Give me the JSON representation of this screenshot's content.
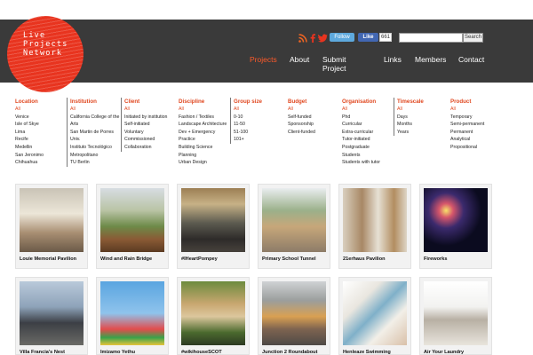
{
  "logo": {
    "line1": "Live",
    "line2": "Projects",
    "line3": "Network"
  },
  "social": {
    "follow_label": "Follow",
    "like_label": "Like",
    "like_count": "661"
  },
  "search": {
    "button_label": "Search",
    "value": ""
  },
  "nav": {
    "items": [
      "Projects",
      "About",
      "Submit",
      "Project",
      "Links",
      "Members",
      "Contact"
    ]
  },
  "colors": {
    "accent": "#e0471f",
    "header_bg": "#3a3a3a",
    "logo_red": "#e8341f"
  },
  "filters": {
    "location": {
      "title": "Location",
      "all": "All",
      "items": [
        "Venice",
        "Isle of Skye",
        "Lima",
        "Recife",
        "Medellin",
        "San Jeronimo",
        "Chihuahua"
      ]
    },
    "institution": {
      "title": "Institution",
      "all": "All",
      "items": [
        "California College of the",
        "Arts",
        "San Martin de Porres",
        "Univ.",
        "Instituto Tecnológico",
        "Metropolitano",
        "TU Berlin"
      ]
    },
    "client": {
      "title": "Client",
      "all": "All",
      "items": [
        "Initiated by institution",
        "Self-initiated",
        "Voluntary",
        "Commissioned",
        "Collaboration"
      ]
    },
    "discipline": {
      "title": "Discipline",
      "all": "All",
      "items": [
        "Fashion / Textiles",
        "Landscape Architecture",
        "Dev + Emergency",
        "Practice",
        "Building Science",
        "Planning",
        "Urban Design"
      ]
    },
    "group_size": {
      "title": "Group size",
      "all": "All",
      "items": [
        "0-10",
        "11-50",
        "51-100",
        "101+"
      ]
    },
    "budget": {
      "title": "Budget",
      "all": "All",
      "items": [
        "Self-funded",
        "Sponsorship",
        "Client-funded"
      ]
    },
    "organisation": {
      "title": "Organisation",
      "all": "All",
      "items": [
        "Phd",
        "Curricular",
        "Extra-curricular",
        "Tutor-initiated",
        "Postgraduate",
        "Students",
        "Students with tutor"
      ]
    },
    "timescale": {
      "title": "Timescale",
      "all": "All",
      "items": [
        "Days",
        "Months",
        "Years"
      ]
    },
    "product": {
      "title": "Product",
      "all": "All",
      "items": [
        "Temporary",
        "Semi-permanent",
        "Permanent",
        "Analytical",
        "Propositional"
      ]
    }
  },
  "projects": [
    {
      "title": "Louie Memorial Pavilion",
      "image": "classroom-photo"
    },
    {
      "title": "Wind and Rain Bridge",
      "image": "bridge-photo"
    },
    {
      "title": "#IHeartPompey",
      "image": "group-photo"
    },
    {
      "title": "Primary School Tunnel",
      "image": "tunnel-photo"
    },
    {
      "title": "21erhaus Pavilion",
      "image": "pavilion-photo"
    },
    {
      "title": "Fireworks",
      "image": "fireworks-photo"
    },
    {
      "title": "Villa Francia's Nest",
      "image": "structure-photo"
    },
    {
      "title": "Imizamo Yethu",
      "image": "bunting-photo"
    },
    {
      "title": "#wikihouseSCOT",
      "image": "wikihouse-photo"
    },
    {
      "title": "Junction 2 Roundabout",
      "image": "roundabout-photo"
    },
    {
      "title": "Henleaze Swimming",
      "image": "drawing-photo"
    },
    {
      "title": "Air Your Laundry",
      "image": "laundry-photo"
    }
  ]
}
